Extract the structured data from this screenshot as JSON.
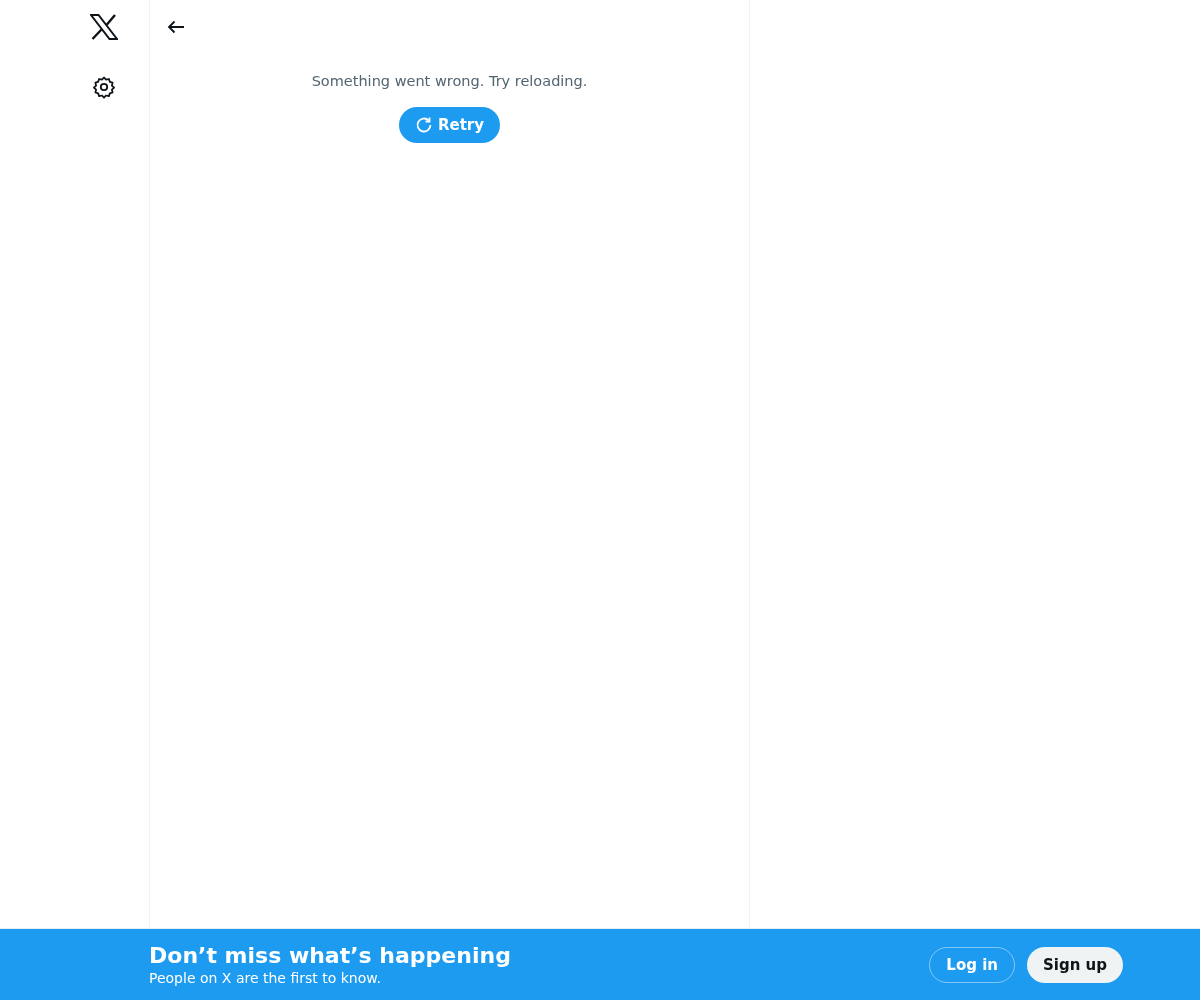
{
  "error": {
    "message": "Something went wrong. Try reloading.",
    "retry_button": "Retry"
  },
  "bottom_bar": {
    "title": "Don’t miss what’s happening",
    "subtitle": "People on X are the first to know.",
    "login_button": "Log in",
    "signup_button": "Sign up"
  }
}
